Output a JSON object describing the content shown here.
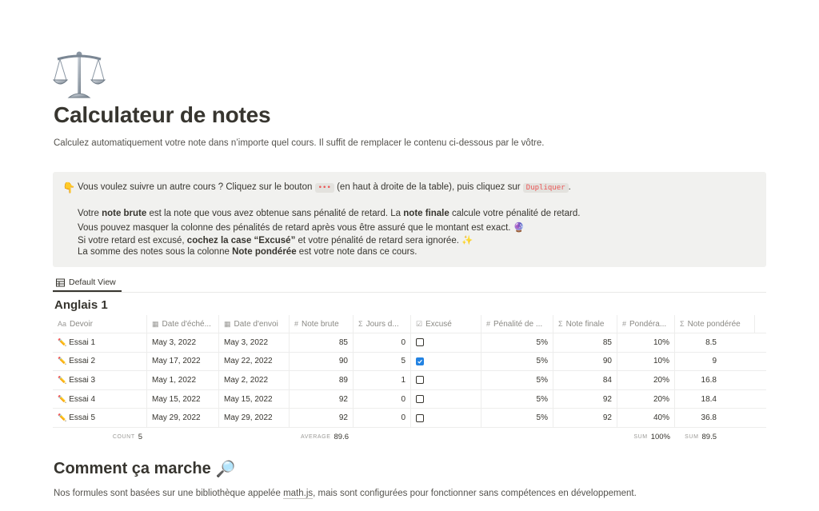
{
  "page": {
    "icon": "balance-scale-icon",
    "title": "Calculateur de notes",
    "description": "Calculez automatiquement votre note dans n’importe quel cours. Il suffit de remplacer le contenu ci-dessous par le vôtre."
  },
  "callout": {
    "emoji": "👇",
    "line1_a": "Vous voulez suivre un autre cours ? Cliquez sur le bouton",
    "line1_code1": "•••",
    "line1_b": "(en haut à droite de la table), puis cliquez sur",
    "line1_code2": "Dupliquer",
    "line1_c": ".",
    "line2_a": "Votre",
    "line2_b": "note brute",
    "line2_c": "est la note que vous avez obtenue sans pénalité de retard. La",
    "line2_d": "note finale",
    "line2_e": "calcule votre pénalité de retard.",
    "line3": "Vous pouvez masquer la colonne des pénalités de retard après vous être assuré que le montant est exact. 🔮",
    "line4_a": "Si votre retard est excusé,",
    "line4_b": "cochez la case “Excusé”",
    "line4_c": "et votre pénalité de retard sera ignorée. ✨",
    "line5_a": "La somme des notes sous la colonne",
    "line5_b": "Note pondérée",
    "line5_c": "est votre note dans ce cours."
  },
  "view_tab": {
    "label": "Default View",
    "icon": "table-icon"
  },
  "table": {
    "title": "Anglais 1",
    "headers": [
      {
        "icon": "Aa",
        "label": "Devoir"
      },
      {
        "icon": "▦",
        "label": "Date d'éché..."
      },
      {
        "icon": "▦",
        "label": "Date d'envoi"
      },
      {
        "icon": "#",
        "label": "Note brute"
      },
      {
        "icon": "Σ",
        "label": "Jours d..."
      },
      {
        "icon": "☑",
        "label": "Excusé"
      },
      {
        "icon": "#",
        "label": "Pénalité de ..."
      },
      {
        "icon": "Σ",
        "label": "Note finale"
      },
      {
        "icon": "#",
        "label": "Pondéra..."
      },
      {
        "icon": "Σ",
        "label": "Note pondérée"
      }
    ],
    "rows": [
      {
        "name": "Essai 1",
        "due": "May 3, 2022",
        "sent": "May 3, 2022",
        "raw": "85",
        "days": "0",
        "excused": false,
        "penalty": "5%",
        "final": "85",
        "weight": "10%",
        "weighted": "8.5"
      },
      {
        "name": "Essai 2",
        "due": "May 17, 2022",
        "sent": "May 22, 2022",
        "raw": "90",
        "days": "5",
        "excused": true,
        "penalty": "5%",
        "final": "90",
        "weight": "10%",
        "weighted": "9"
      },
      {
        "name": "Essai 3",
        "due": "May 1, 2022",
        "sent": "May 2, 2022",
        "raw": "89",
        "days": "1",
        "excused": false,
        "penalty": "5%",
        "final": "84",
        "weight": "20%",
        "weighted": "16.8"
      },
      {
        "name": "Essai 4",
        "due": "May 15, 2022",
        "sent": "May 15, 2022",
        "raw": "92",
        "days": "0",
        "excused": false,
        "penalty": "5%",
        "final": "92",
        "weight": "20%",
        "weighted": "18.4"
      },
      {
        "name": "Essai 5",
        "due": "May 29, 2022",
        "sent": "May 29, 2022",
        "raw": "92",
        "days": "0",
        "excused": false,
        "penalty": "5%",
        "final": "92",
        "weight": "40%",
        "weighted": "36.8"
      }
    ],
    "footer": {
      "count_label": "COUNT",
      "count_value": "5",
      "average_label": "AVERAGE",
      "average_value": "89.6",
      "sum_weight_label": "SUM",
      "sum_weight_value": "100%",
      "sum_weighted_label": "SUM",
      "sum_weighted_value": "89.5"
    }
  },
  "section": {
    "title": "Comment ça marche",
    "title_emoji": "🔎",
    "desc_a": "Nos formules sont basées sur une bibliothèque appelée",
    "desc_link": "math.js",
    "desc_b": ", mais sont configurées pour fonctionner sans compétences en développement."
  },
  "colors": {
    "accent_checkbox": "#2383e2",
    "code_text": "#eb5757",
    "callout_bg": "#f1f1ef"
  }
}
